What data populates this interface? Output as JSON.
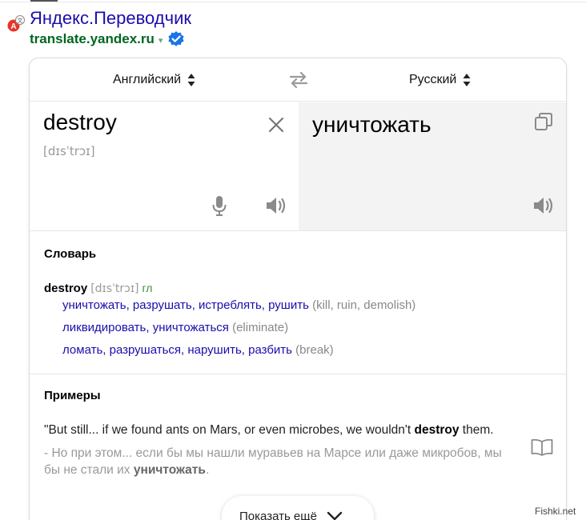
{
  "header": {
    "title": "Яндекс.Переводчик",
    "url": "translate.yandex.ru",
    "url_caret": "▾"
  },
  "translator": {
    "source_lang": "Английский",
    "target_lang": "Русский",
    "source_text": "destroy",
    "source_transcription": "[dɪsˈtrɔɪ]",
    "target_text": "уничтожать"
  },
  "dictionary": {
    "title": "Словарь",
    "word": "destroy",
    "transcription": "[dɪsˈtrɔɪ]",
    "pos": "гл",
    "senses": [
      {
        "translations": "уничтожать, разрушать, истреблять, рушить",
        "synonyms": "(kill, ruin, demolish)"
      },
      {
        "translations": "ликвидировать, уничтожаться",
        "synonyms": "(eliminate)"
      },
      {
        "translations": "ломать, разрушаться, нарушить, разбить",
        "synonyms": "(break)"
      }
    ]
  },
  "examples": {
    "title": "Примеры",
    "src_before": "\"But still... if we found ants on Mars, or even microbes, we wouldn't ",
    "src_bold": "destroy",
    "src_after": " them.",
    "tgt_before": "- Но при этом... если бы мы нашли муравьев на Марсе или даже микробов, мы бы не стали их ",
    "tgt_bold": "уничтожать",
    "tgt_after": "."
  },
  "more_button": {
    "label": "Показать ещё"
  },
  "watermark": "Fishki.net",
  "colors": {
    "link": "#1a0dab",
    "url_green": "#006621",
    "verified_blue": "#1a73e8",
    "target_pane_bg": "#f3f3f3",
    "pos_green": "#3a8f3a"
  },
  "icons": {
    "app": "yandex-translate-icon",
    "verified": "verified-badge-icon",
    "swap": "swap-arrows-icon",
    "clear": "close-icon",
    "mic": "microphone-icon",
    "speaker": "speaker-icon",
    "copy": "copy-icon",
    "book": "book-icon",
    "more": "chevron-down-icon"
  }
}
